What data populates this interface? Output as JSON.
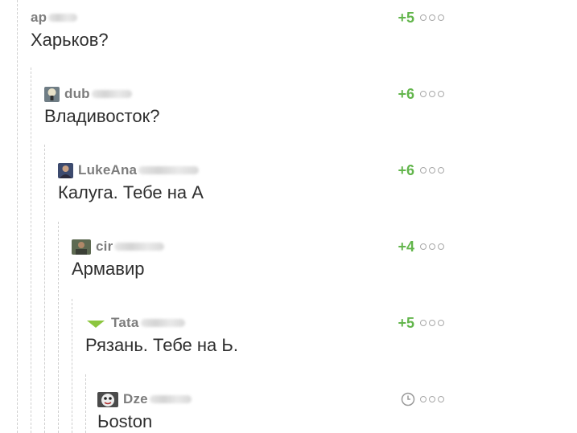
{
  "comments": [
    {
      "username": "ap",
      "avatar_icon": "none",
      "rating": "+5",
      "text": "Харьков?"
    },
    {
      "username": "dub",
      "avatar_icon": "lamp-avatar-icon",
      "rating": "+6",
      "text": "Владивосток?"
    },
    {
      "username": "LukeAna",
      "avatar_icon": "person-avatar-icon",
      "rating": "+6",
      "text": "Калуга. Тебе на А"
    },
    {
      "username": "cir",
      "avatar_icon": "photo-avatar-icon",
      "rating": "+4",
      "text": "Армавир"
    },
    {
      "username": "Tata",
      "avatar_icon": "green-triangle-avatar-icon",
      "rating": "+5",
      "text": "Рязань. Тебе на Ь."
    },
    {
      "username": "Dze",
      "avatar_icon": "mask-avatar-icon",
      "rating": "",
      "status_icon": "clock-icon",
      "text": "Ьoston"
    }
  ],
  "menu_icon": "more-dots-icon",
  "colors": {
    "rating": "#62b54b",
    "username": "#7d7d7d",
    "thread_line": "#cfcfcf"
  }
}
